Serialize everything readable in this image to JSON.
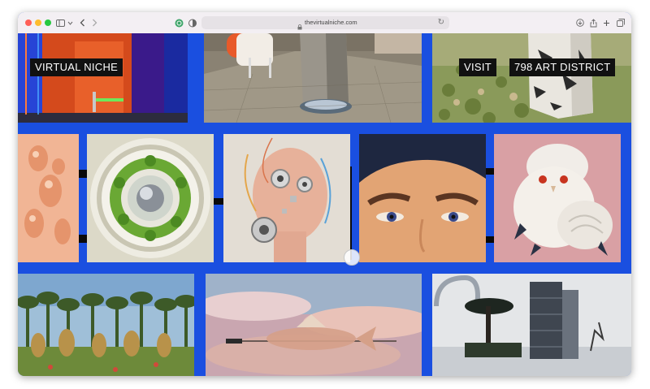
{
  "browser": {
    "url": "thevirtualniche.com",
    "icons": [
      "sidebar-icon",
      "chevron-down-icon",
      "back-icon",
      "forward-icon",
      "extension-icon",
      "shield-icon",
      "lock-icon",
      "reload-icon",
      "download-icon",
      "share-icon",
      "new-tab-icon",
      "tabs-overview-icon"
    ]
  },
  "site": {
    "title_label": "VIRTUAL NICHE",
    "visit_label": "VISIT",
    "district_label": "798 ART DISTRICT",
    "background_color": "#1a4fe0"
  },
  "gallery": {
    "row1": [
      "orange-neon-room",
      "concrete-pillar-sculpture",
      "marble-block-in-grass"
    ],
    "row2": [
      "peach-figures",
      "green-ring-sculpture",
      "cyborg-head",
      "stylized-face-closeup",
      "white-owl-sculpture"
    ],
    "row3": [
      "golden-figures-forest",
      "floating-fish-sword",
      "futuristic-building"
    ]
  }
}
